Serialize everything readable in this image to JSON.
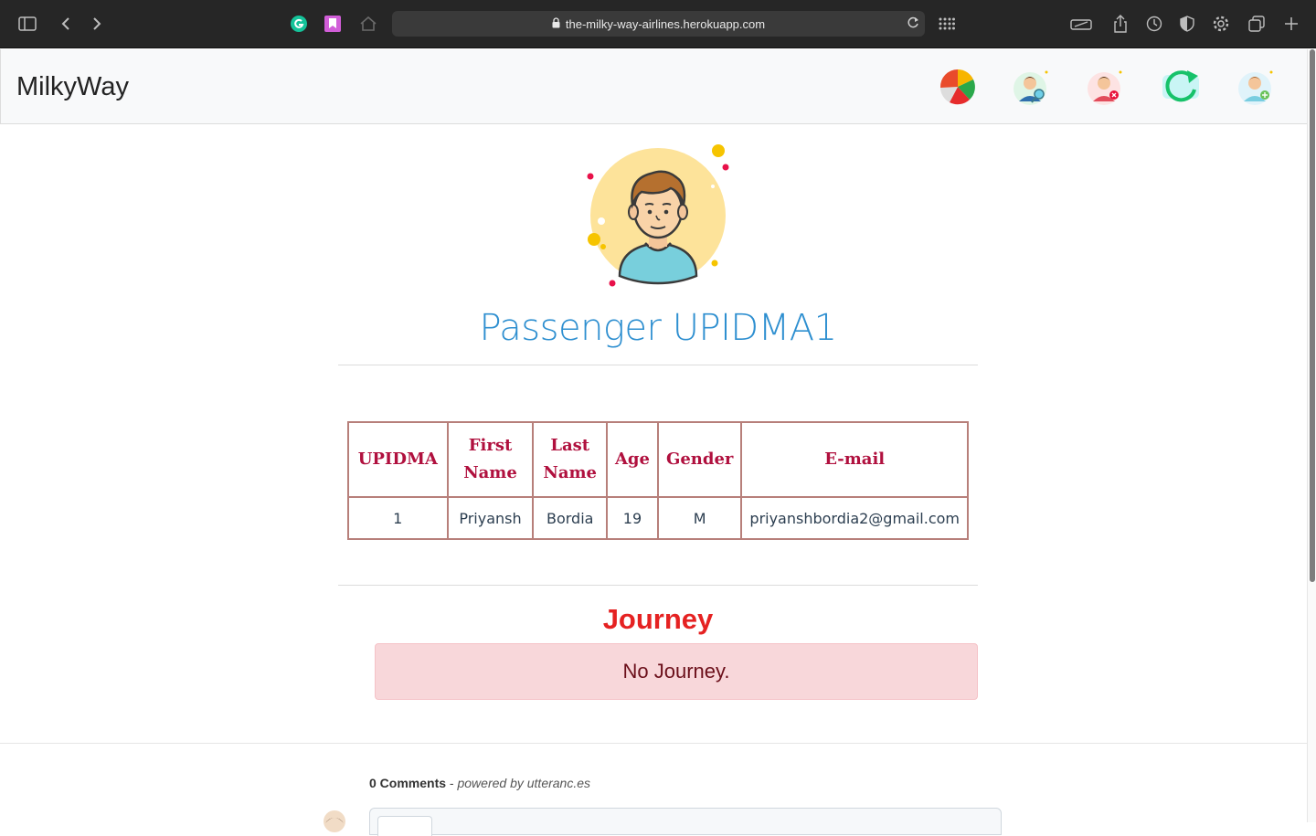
{
  "browser": {
    "url": "the-milky-way-airlines.herokuapp.com"
  },
  "navbar": {
    "brand": "MilkyWay",
    "icons": [
      "stats-pie-icon",
      "search-passenger-icon",
      "delete-passenger-icon",
      "refresh-icon",
      "add-passenger-icon"
    ]
  },
  "passenger": {
    "title": "Passenger UPIDMA1",
    "table": {
      "headers": [
        "UPIDMA",
        "First Name",
        "Last Name",
        "Age",
        "Gender",
        "E-mail"
      ],
      "rows": [
        [
          "1",
          "Priyansh",
          "Bordia",
          "19",
          "M",
          "priyanshbordia2@gmail.com"
        ]
      ]
    }
  },
  "journey": {
    "title": "Journey",
    "message": "No Journey."
  },
  "comments": {
    "count_label": "0 Comments",
    "powered_prefix": " - ",
    "powered_label": "powered by utteranc.es"
  }
}
